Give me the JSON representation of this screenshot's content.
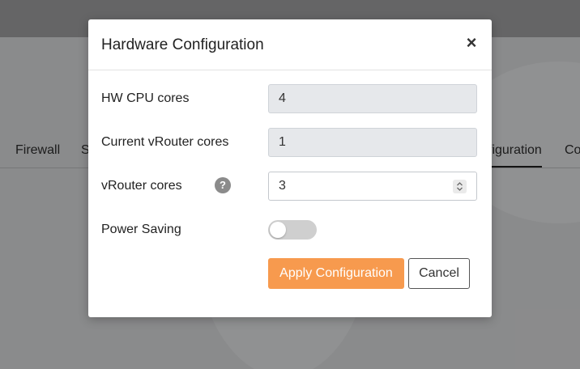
{
  "background": {
    "tabs": [
      {
        "label": "Firewall"
      },
      {
        "label": "S"
      },
      {
        "label": "figuration"
      },
      {
        "label": "Co"
      }
    ]
  },
  "modal": {
    "title": "Hardware Configuration",
    "close_glyph": "×",
    "fields": {
      "hw_cpu_cores": {
        "label": "HW CPU cores",
        "value": "4"
      },
      "current_vrouter_cores": {
        "label": "Current vRouter cores",
        "value": "1"
      },
      "vrouter_cores": {
        "label": "vRouter cores",
        "value": "3",
        "help_glyph": "?"
      },
      "power_saving": {
        "label": "Power Saving",
        "enabled": false
      }
    },
    "buttons": {
      "apply_label": "Apply Configuration",
      "cancel_label": "Cancel"
    }
  },
  "colors": {
    "accent": "#f79a4e",
    "toggle_off": "#cfcfcf"
  },
  "icons": {
    "close": "close-icon",
    "help": "help-icon",
    "spinner": "spinner-arrows-icon"
  }
}
